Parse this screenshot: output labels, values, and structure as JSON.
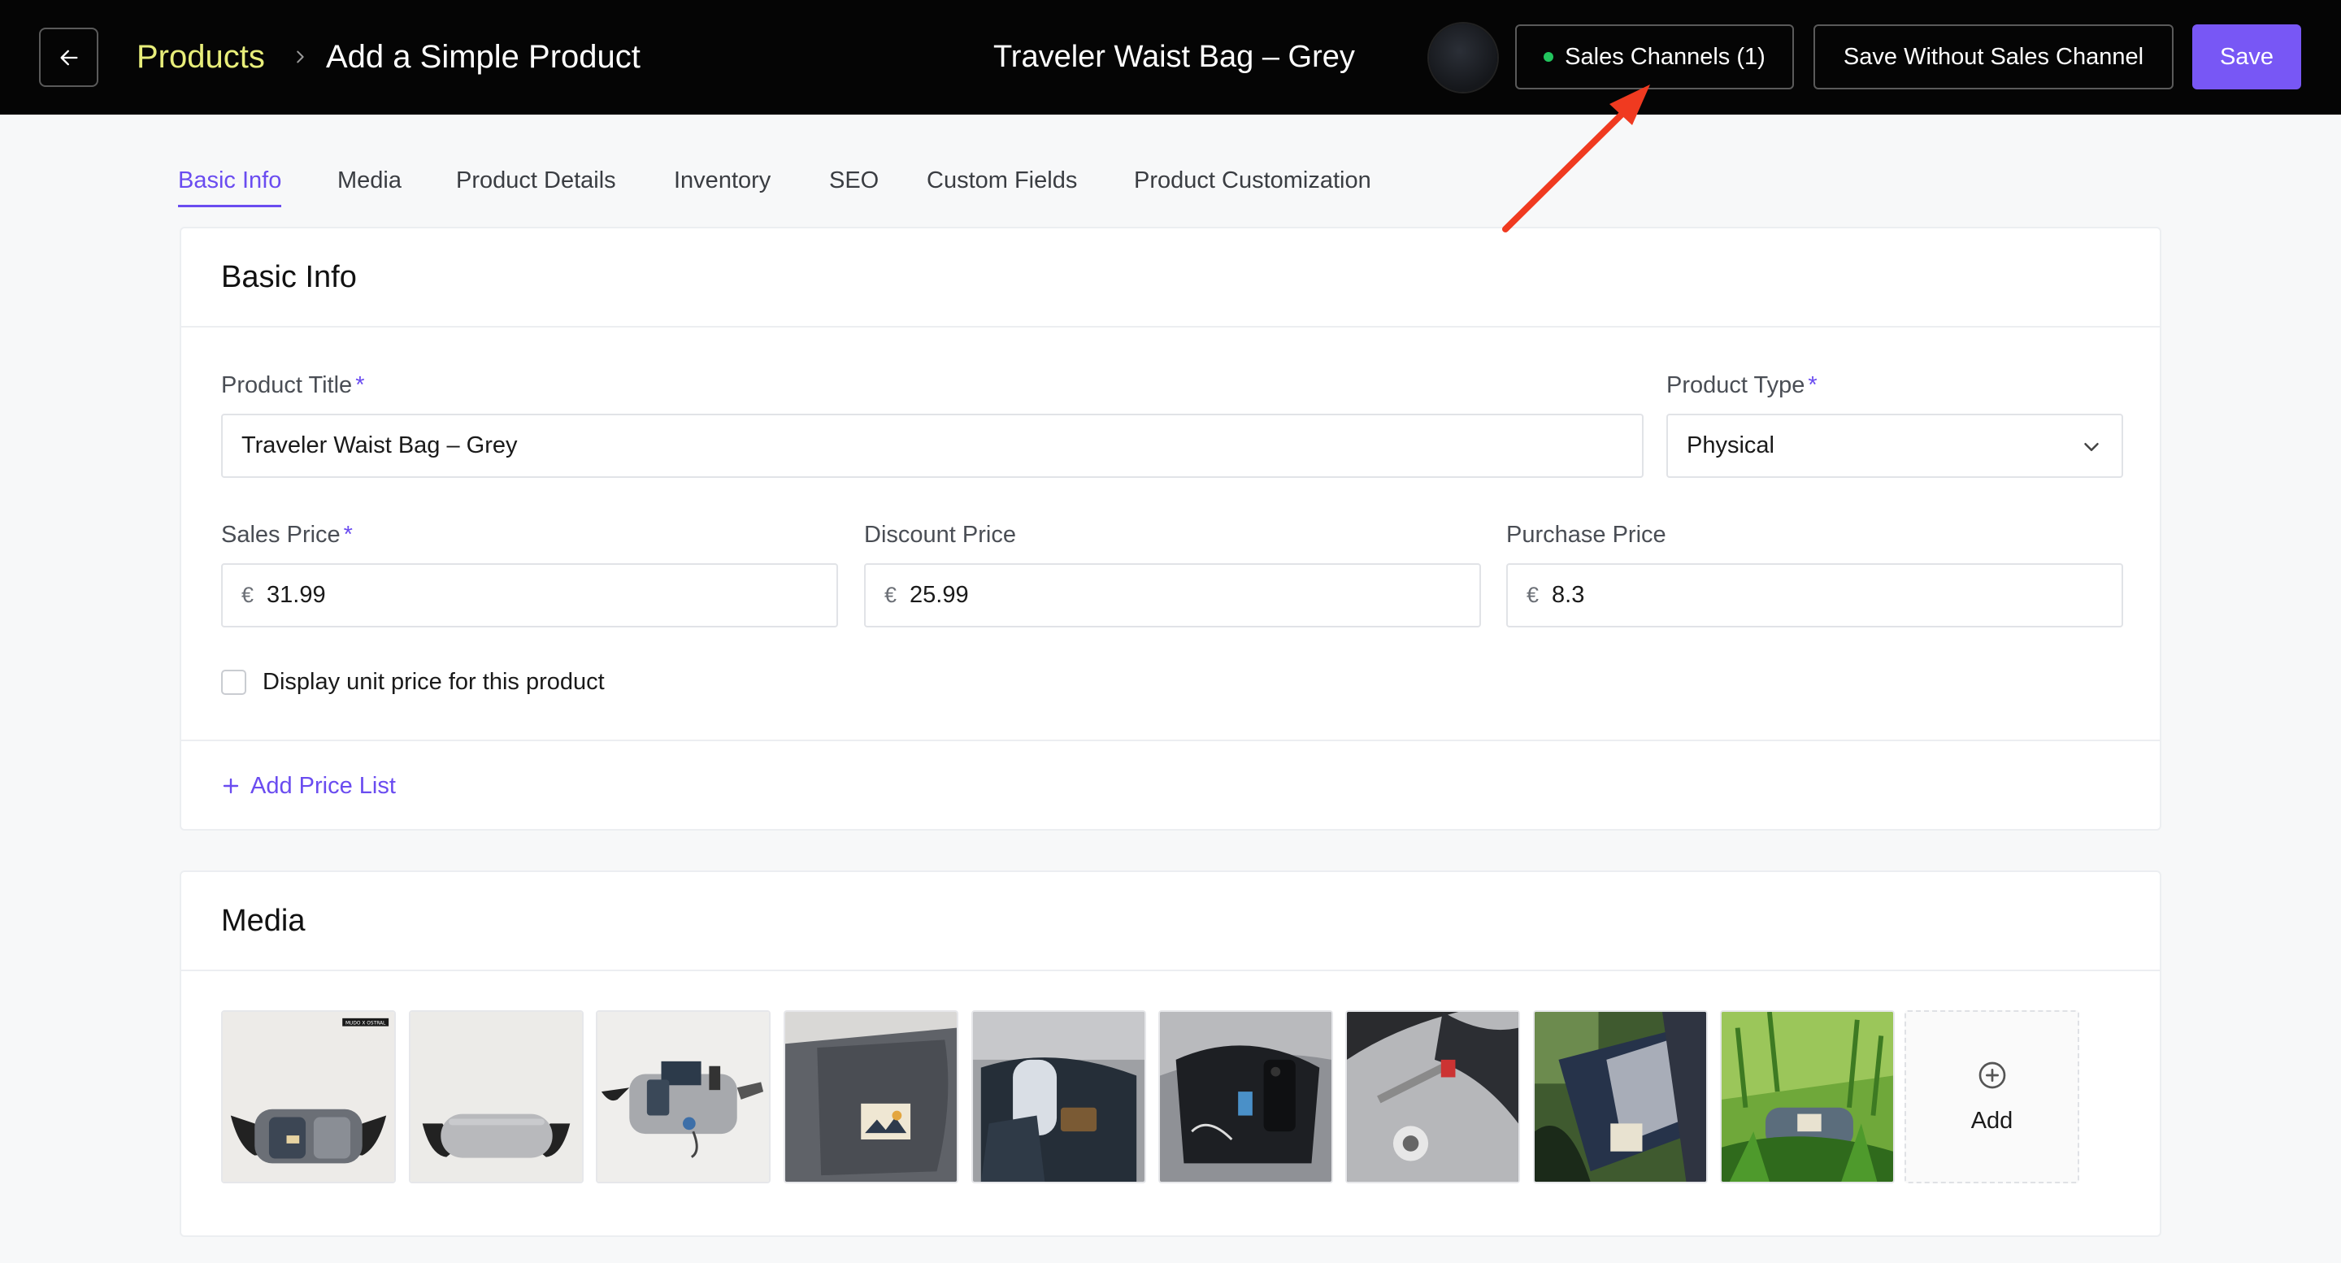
{
  "header": {
    "breadcrumb_root": "Products",
    "page_title": "Add a Simple Product",
    "product_name": "Traveler Waist Bag – Grey",
    "sales_channels_label": "Sales Channels (1)",
    "save_without_label": "Save Without Sales Channel",
    "save_label": "Save"
  },
  "tabs": [
    "Basic Info",
    "Media",
    "Product Details",
    "Inventory",
    "SEO",
    "Custom Fields",
    "Product Customization"
  ],
  "active_tab": "Basic Info",
  "basic_info": {
    "title": "Basic Info",
    "product_title_label": "Product Title",
    "product_title_value": "Traveler Waist Bag – Grey",
    "product_type_label": "Product Type",
    "product_type_value": "Physical",
    "sales_price_label": "Sales Price",
    "sales_price_value": "31.99",
    "discount_price_label": "Discount Price",
    "discount_price_value": "25.99",
    "purchase_price_label": "Purchase Price",
    "purchase_price_value": "8.3",
    "currency_symbol": "€",
    "required_mark": "*",
    "unit_price_label": "Display unit price for this product",
    "unit_price_checked": false,
    "add_price_list_label": "Add Price List"
  },
  "media": {
    "title": "Media",
    "add_label": "Add",
    "image_count": 9,
    "thumb_badge": "MUDO X OSTRAL"
  },
  "colors": {
    "topbar_bg": "#050505",
    "accent": "#7857f5",
    "breadcrumb_root": "#e8ee7a",
    "status_dot": "#22c55e",
    "annotation_arrow": "#f03a20"
  }
}
